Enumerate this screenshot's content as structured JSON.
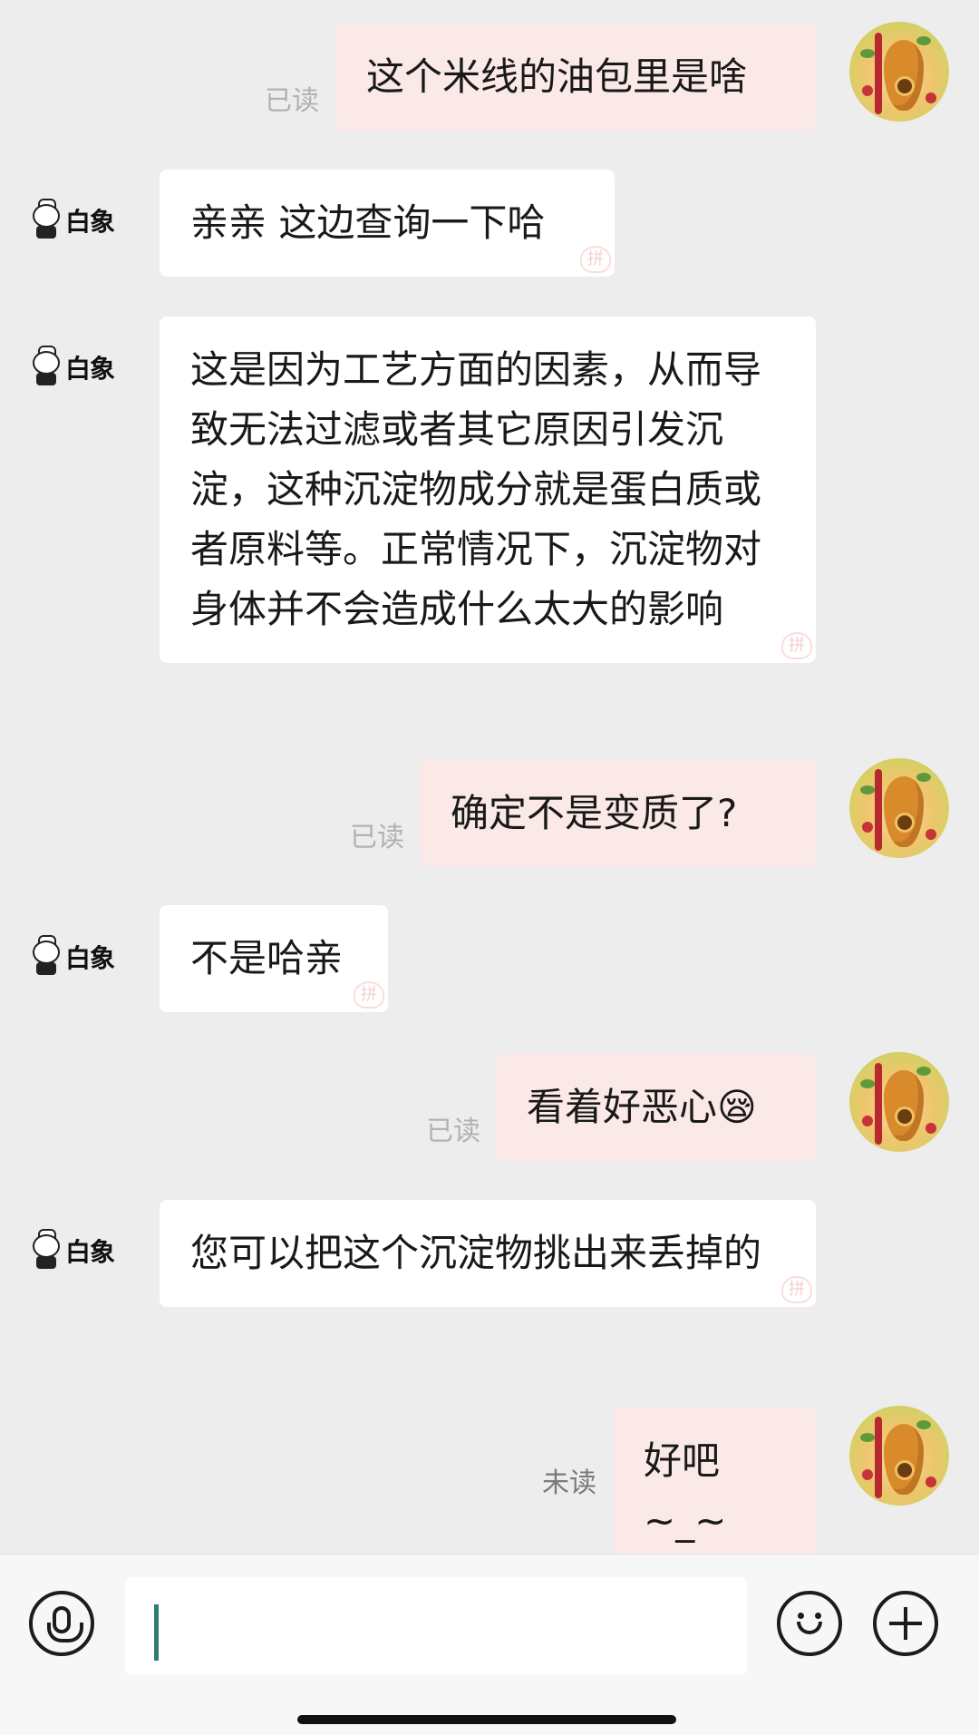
{
  "messages": [
    {
      "side": "me",
      "text": "这个米线的油包里是啥",
      "receipt": "已读"
    },
    {
      "side": "them",
      "text": "亲亲 这边查询一下哈"
    },
    {
      "side": "them",
      "text": "这是因为工艺方面的因素，从而导致无法过滤或者其它原因引发沉淀，这种沉淀物成分就是蛋白质或者原料等。正常情况下，沉淀物对身体并不会造成什么太大的影响"
    },
    {
      "side": "me",
      "text": "确定不是变质了?",
      "receipt": "已读"
    },
    {
      "side": "them",
      "text": "不是哈亲"
    },
    {
      "side": "me",
      "text": "看着好恶心😪",
      "receipt": "已读"
    },
    {
      "side": "them",
      "text": "您可以把这个沉淀物挑出来丢掉的"
    },
    {
      "side": "me",
      "text": "好吧~_~",
      "receipt": "未读"
    }
  ],
  "merchant": {
    "brand": "白象"
  },
  "input": {
    "value": ""
  },
  "colors": {
    "my_bubble": "#fbe9e7",
    "their_bubble": "#ffffff",
    "background": "#ededed",
    "caret": "#2e7d70"
  },
  "icons": {
    "voice": "microphone-icon",
    "emoji": "smiley-icon",
    "more": "plus-icon"
  }
}
